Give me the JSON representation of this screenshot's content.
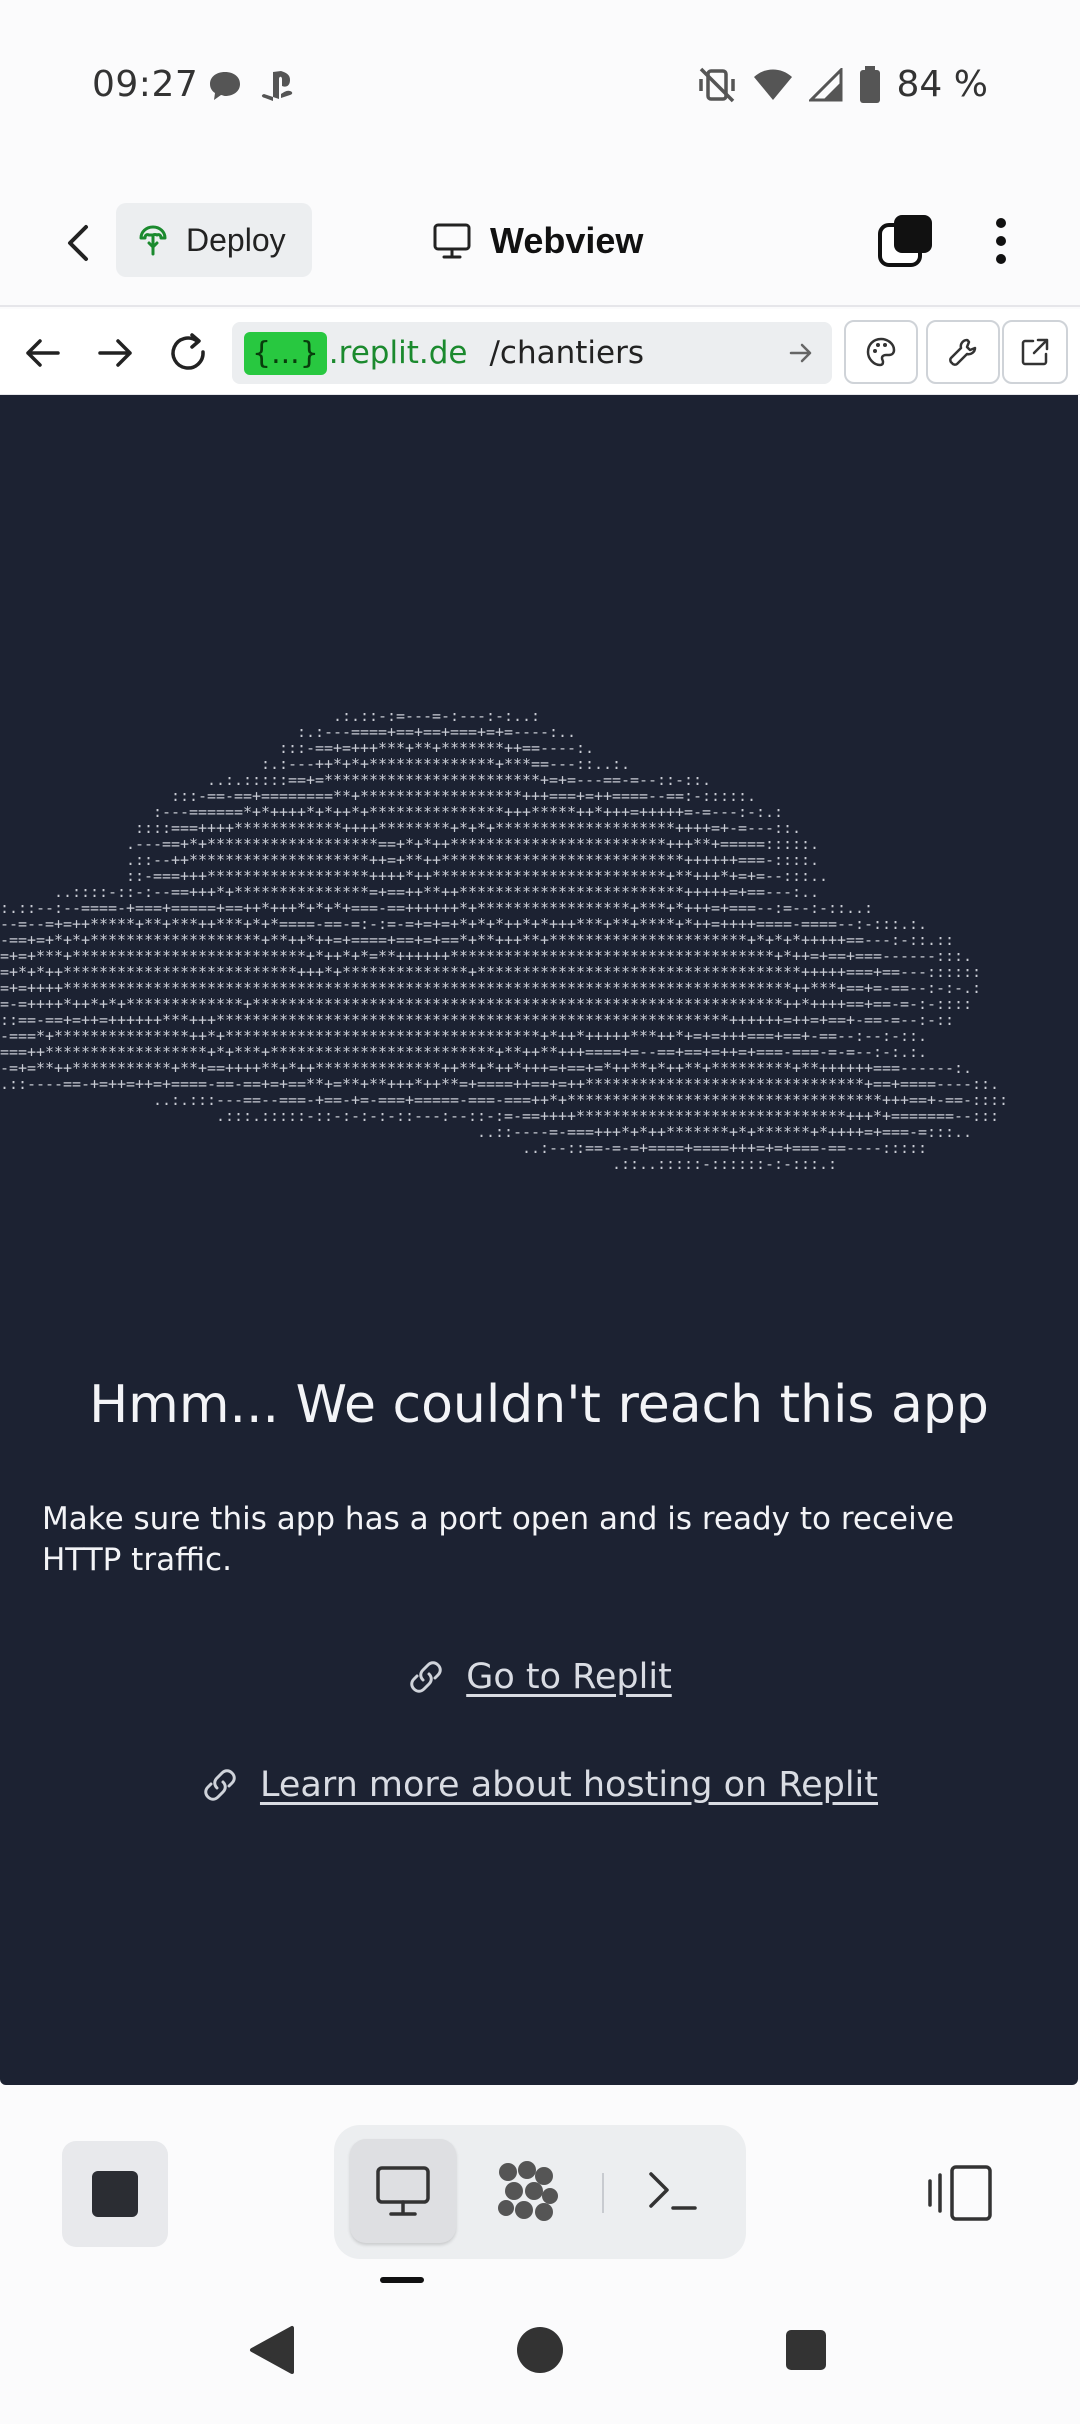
{
  "status_bar": {
    "time": "09:27",
    "battery": "84 %",
    "icons": [
      "chat-bubble-icon",
      "playstation-icon",
      "vibrate-off-icon",
      "wifi-icon",
      "signal-icon",
      "battery-icon"
    ]
  },
  "header": {
    "deploy_label": "Deploy",
    "title": "Webview"
  },
  "url_bar": {
    "badge": "{...}",
    "domain": ".replit.de",
    "path": "/chantiers"
  },
  "webview": {
    "error_title": "Hmm... We couldn't reach this app",
    "error_description": "Make sure this app has a port open and is ready to receive HTTP traffic.",
    "links": [
      {
        "label": "Go to Replit"
      },
      {
        "label": "Learn more about hosting on Replit"
      }
    ]
  },
  "colors": {
    "webview_bg": "#1c2232",
    "url_badge": "#28c840",
    "url_domain": "#1b8a2e",
    "deploy_icon": "#1b8a2e"
  }
}
